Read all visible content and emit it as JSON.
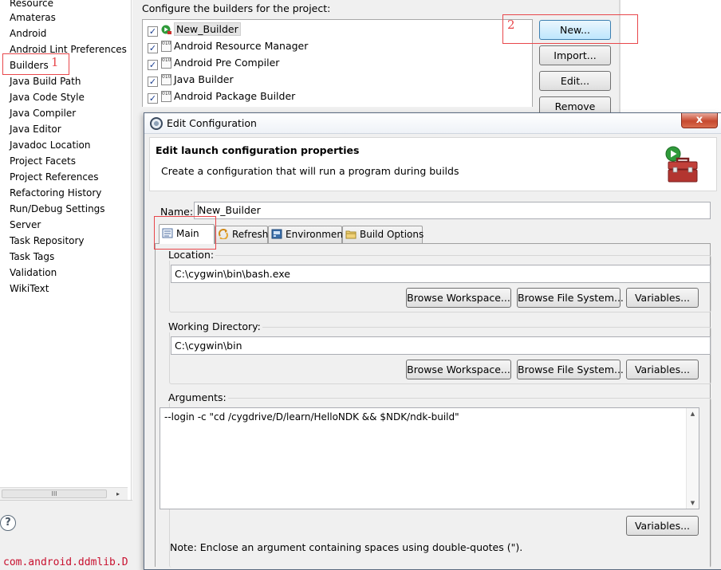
{
  "left_tree": {
    "items": [
      "Resource",
      "Amateras",
      "Android",
      "Android Lint Preferences",
      "Builders",
      "Java Build Path",
      "Java Code Style",
      "Java Compiler",
      "Java Editor",
      "Javadoc Location",
      "Project Facets",
      "Project References",
      "Refactoring History",
      "Run/Debug Settings",
      "Server",
      "Task Repository",
      "Task Tags",
      "Validation",
      "WikiText"
    ],
    "scroll_grip": "III",
    "scroll_arrow": "▸"
  },
  "help_icon_glyph": "?",
  "console_text": "com.android.ddmlib.D",
  "builders": {
    "header": "Configure the builders for the project:",
    "list": [
      "New_Builder",
      "Android Resource Manager",
      "Android Pre Compiler",
      "Java Builder",
      "Android Package Builder"
    ],
    "checkmark": "✓",
    "binary_icon_text": "010",
    "buttons": {
      "new": "New...",
      "import": "Import...",
      "edit": "Edit...",
      "remove": "Remove"
    }
  },
  "annotations": {
    "one": "1",
    "two": "2",
    "color": "#e8474b"
  },
  "dialog": {
    "title": "Edit Configuration",
    "close_glyph": "x",
    "banner_title": "Edit launch configuration properties",
    "banner_desc": "Create a configuration that will run a program during builds",
    "name_label": "Name:",
    "name_value": "New_Builder",
    "tabs": [
      "Main",
      "Refresh",
      "Environment",
      "Build Options"
    ],
    "location": {
      "label": "Location:",
      "value": "C:\\cygwin\\bin\\bash.exe",
      "buttons": [
        "Browse Workspace...",
        "Browse File System...",
        "Variables..."
      ]
    },
    "working_dir": {
      "label": "Working Directory:",
      "value": "C:\\cygwin\\bin",
      "buttons": [
        "Browse Workspace...",
        "Browse File System...",
        "Variables..."
      ]
    },
    "arguments": {
      "label": "Arguments:",
      "value": "--login -c \"cd /cygdrive/D/learn/HelloNDK && $NDK/ndk-build\"",
      "variables_button": "Variables...",
      "scroll_up": "▲",
      "scroll_down": "▼"
    },
    "note": "Note: Enclose an argument containing spaces using double-quotes (\")."
  }
}
